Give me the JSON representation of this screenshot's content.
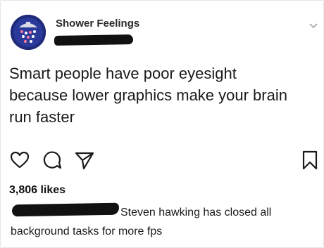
{
  "post": {
    "username": "Shower Feelings",
    "caption_lines": [
      "Smart people have poor eyesight",
      "because lower graphics make your brain",
      "run faster"
    ],
    "likes": "3,806 likes"
  },
  "actions": {
    "like_icon": "heart-outline-icon",
    "comment_icon": "speech-bubble-icon",
    "share_icon": "paper-plane-icon",
    "save_icon": "bookmark-outline-icon"
  },
  "comment": {
    "line1": "Steven hawking has closed all",
    "line2": "background tasks for more fps"
  },
  "colors": {
    "text": "#1a1a1a",
    "avatar_bg": "#1f2a7a",
    "redaction": "#111111"
  }
}
